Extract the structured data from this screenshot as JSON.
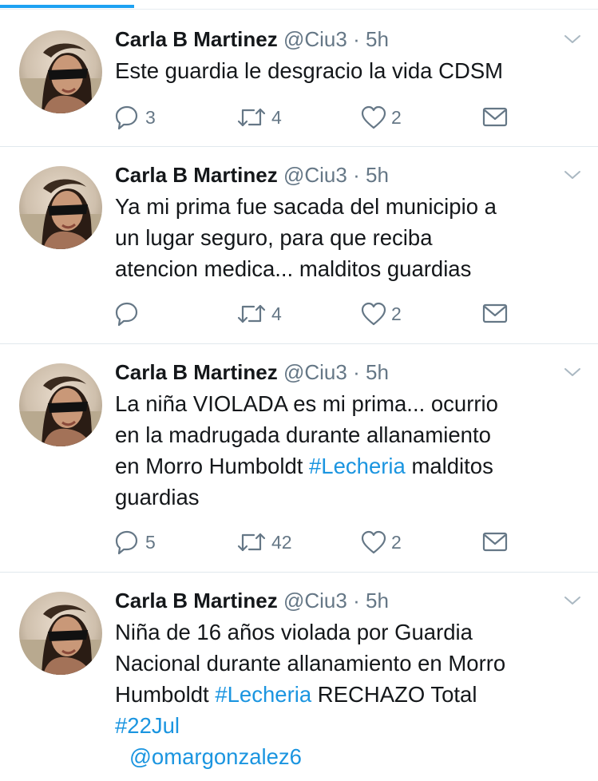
{
  "tweets": [
    {
      "name": "Carla B Martinez",
      "handle": "@Ciu3",
      "time": "5h",
      "text": [
        "Este guardia le desgracio la vida CDSM"
      ],
      "replies": "3",
      "retweets": "4",
      "likes": "2"
    },
    {
      "name": "Carla B Martinez",
      "handle": "@Ciu3",
      "time": "5h",
      "text": [
        "Ya mi prima fue sacada del municipio a",
        "un lugar seguro, para que reciba",
        "atencion medica... malditos guardias"
      ],
      "replies": "",
      "retweets": "4",
      "likes": "2"
    },
    {
      "name": "Carla B Martinez",
      "handle": "@Ciu3",
      "time": "5h",
      "line1": "La niña VIOLADA es mi prima... ocurrio",
      "line2": "en la madrugada durante allanamiento",
      "line3_before": "en Morro Humboldt ",
      "hashtag": "#Lecheria",
      "line3_after": " malditos",
      "line4": "guardias",
      "replies": "5",
      "retweets": "42",
      "likes": "2"
    },
    {
      "name": "Carla B Martinez",
      "handle": "@Ciu3",
      "time": "5h",
      "line1": "Niña de 16 años violada por Guardia",
      "line2": "Nacional durante allanamiento en Morro",
      "line3_before": "Humboldt ",
      "hashtag": "#Lecheria",
      "line3_after": " RECHAZO Total",
      "hashtag2": "#22Jul",
      "mention": "@omargonzalez6"
    }
  ],
  "separator": "·",
  "icons": {
    "reply": "reply-icon",
    "retweet": "retweet-icon",
    "like": "heart-icon",
    "message": "envelope-icon",
    "menu": "chevron-down-icon"
  },
  "colors": {
    "accent": "#1da1f2",
    "link": "#1b95e0",
    "muted": "#657786",
    "text": "#14171a"
  }
}
